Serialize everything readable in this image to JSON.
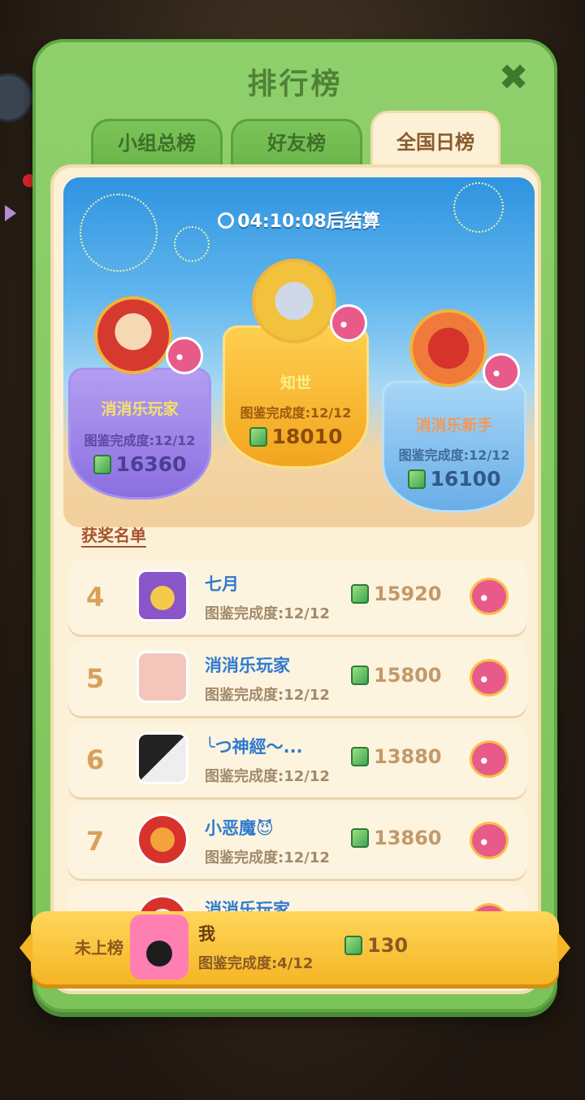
{
  "window": {
    "title": "排行榜"
  },
  "tabs": [
    {
      "label": "小组总榜"
    },
    {
      "label": "好友榜"
    },
    {
      "label": "全国日榜"
    }
  ],
  "timer": {
    "text": "04:10:08后结算"
  },
  "podium": {
    "first": {
      "name": "知世",
      "progress": "图鉴完成度:12/12",
      "score": "18010"
    },
    "second": {
      "name": "消消乐玩家",
      "progress": "图鉴完成度:12/12",
      "score": "16360"
    },
    "third": {
      "name": "消消乐新手",
      "progress": "图鉴完成度:12/12",
      "score": "16100"
    }
  },
  "award_list_label": "获奖名单",
  "rows": [
    {
      "rank": "4",
      "name": "七月",
      "progress": "图鉴完成度:12/12",
      "score": "15920"
    },
    {
      "rank": "5",
      "name": "消消乐玩家",
      "progress": "图鉴完成度:12/12",
      "score": "15800"
    },
    {
      "rank": "6",
      "name": "╰つ神經～...",
      "progress": "图鉴完成度:12/12",
      "score": "13880"
    },
    {
      "rank": "7",
      "name": "小恶魔😈",
      "progress": "图鉴完成度:12/12",
      "score": "13860"
    },
    {
      "rank": "",
      "name": "消消乐玩家",
      "progress": "",
      "score": ""
    }
  ],
  "me": {
    "status": "未上榜",
    "name": "我",
    "progress": "图鉴完成度:4/12",
    "score": "130"
  },
  "colors": {
    "panel": "#7cc45a",
    "inner": "#fcf1d6",
    "rank_text": "#d9a05b",
    "name_text": "#2f7ad0",
    "me_bar": "#f5b524"
  }
}
